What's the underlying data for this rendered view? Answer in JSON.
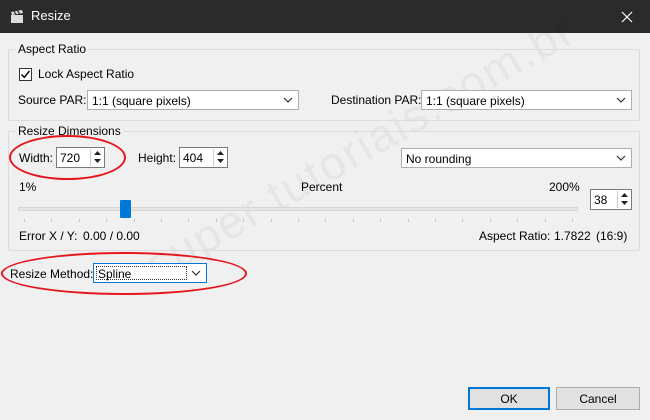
{
  "window": {
    "title": "Resize"
  },
  "aspect_ratio": {
    "group_label": "Aspect Ratio",
    "lock_label": "Lock Aspect Ratio",
    "lock_checked": true,
    "source_par_label": "Source PAR:",
    "source_par_value": "1:1 (square pixels)",
    "dest_par_label": "Destination PAR:",
    "dest_par_value": "1:1 (square pixels)"
  },
  "resize_dimensions": {
    "group_label": "Resize Dimensions",
    "width_label": "Width:",
    "width_value": "720",
    "height_label": "Height:",
    "height_value": "404",
    "rounding_value": "No rounding",
    "min_label": "1%",
    "mid_label": "Percent",
    "max_label": "200%",
    "percent_value": "38",
    "error_label": "Error X / Y:",
    "error_value": "0.00 / 0.00",
    "aspect_label": "Aspect Ratio:",
    "aspect_value": "1.7822",
    "aspect_ratio_text": "(16:9)"
  },
  "resize_method": {
    "label": "Resize Method:",
    "value": "Spline"
  },
  "buttons": {
    "ok": "OK",
    "cancel": "Cancel"
  },
  "watermark": "super tutoriais.com.br",
  "colors": {
    "titlebar": "#2b2b2b",
    "accent": "#0078d7",
    "annotation": "#e5161c"
  }
}
